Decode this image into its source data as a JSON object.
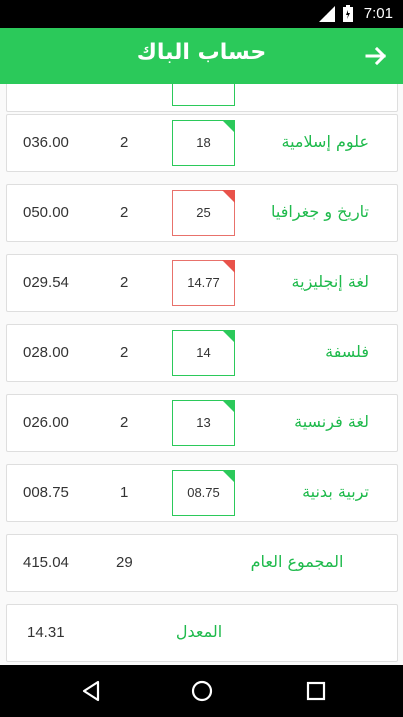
{
  "status": {
    "time": "7:01"
  },
  "app_bar": {
    "title": "حساب الباك"
  },
  "partial_row": {
    "grade": ""
  },
  "subjects": [
    {
      "name": "علوم إسلامية",
      "grade": "18",
      "coef": "2",
      "total": "036.00",
      "status": "pass"
    },
    {
      "name": "تاريخ و جغرافيا",
      "grade": "25",
      "coef": "2",
      "total": "050.00",
      "status": "fail"
    },
    {
      "name": "لغة إنجليزية",
      "grade": "14.77",
      "coef": "2",
      "total": "029.54",
      "status": "fail"
    },
    {
      "name": "فلسفة",
      "grade": "14",
      "coef": "2",
      "total": "028.00",
      "status": "pass"
    },
    {
      "name": "لغة فرنسية",
      "grade": "13",
      "coef": "2",
      "total": "026.00",
      "status": "pass"
    },
    {
      "name": "تربية بدنية",
      "grade": "08.75",
      "coef": "1",
      "total": "008.75",
      "status": "pass"
    }
  ],
  "summary": {
    "sum_label": "المجموع العام",
    "sum_coef": "29",
    "sum_total": "415.04",
    "avg_label": "المعدل",
    "avg_value": "14.31"
  },
  "colors": {
    "accent": "#2bc95a",
    "text_green": "#1fba4c",
    "warn": "#e8524a"
  }
}
